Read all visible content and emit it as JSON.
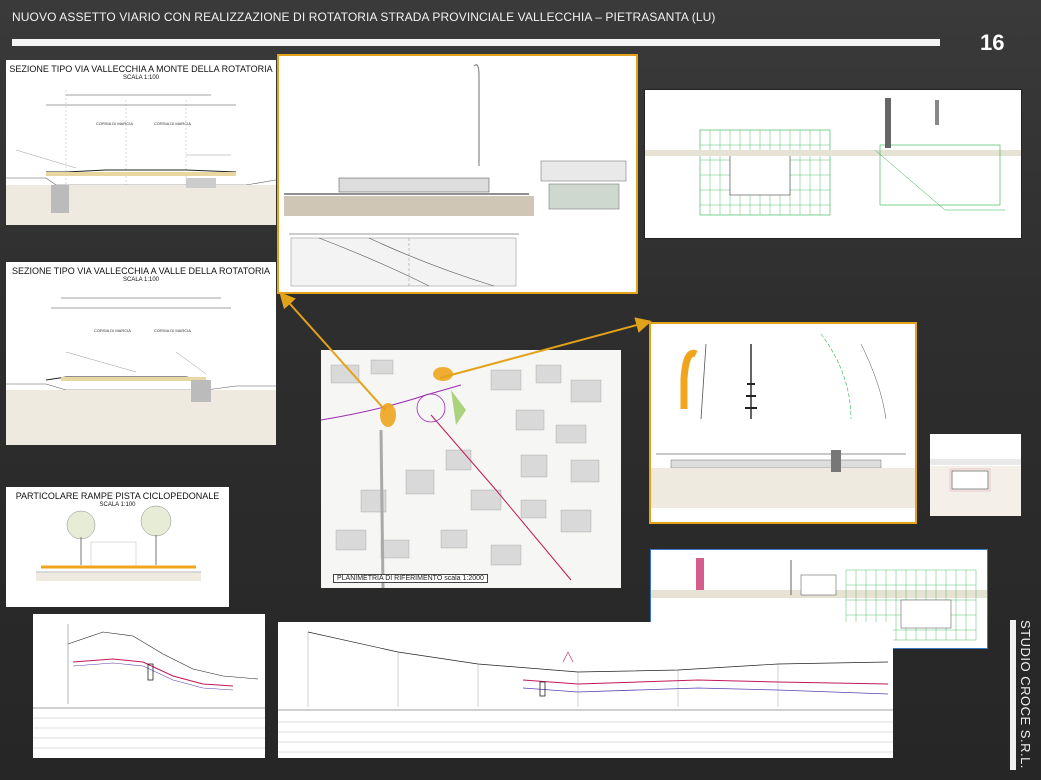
{
  "header": {
    "title": "NUOVO ASSETTO VIARIO CON REALIZZAZIONE DI ROTATORIA STRADA PROVINCIALE VALLECCHIA – PIETRASANTA (LU)",
    "page_number": "16"
  },
  "footer": {
    "studio": "STUDIO CROCE S.R.L."
  },
  "panels": {
    "sezione_monte": {
      "title": "SEZIONE TIPO  VIA VALLECCHIA A MONTE DELLA ROTATORIA",
      "scale": "SCALA 1:100"
    },
    "sezione_valle": {
      "title": "SEZIONE TIPO  VIA VALLECCHIA A VALLE DELLA ROTATORIA",
      "scale": "SCALA 1:100"
    },
    "rampe": {
      "title": "PARTICOLARE RAMPE PISTA CICLOPEDONALE",
      "scale": "SCALA 1:100"
    },
    "planimetria": {
      "label": "PLANIMETRIA DI RIFERIMENTO scala 1:2000"
    },
    "corsia": {
      "label": "CORSIA DI MARCIA"
    }
  },
  "colors": {
    "accent_gold": "#e2a21a",
    "accent_blue": "#3a78c6",
    "road_orange": "#f0a51e",
    "profile_magenta": "#c2185b",
    "grid_green": "#2bb24c"
  }
}
